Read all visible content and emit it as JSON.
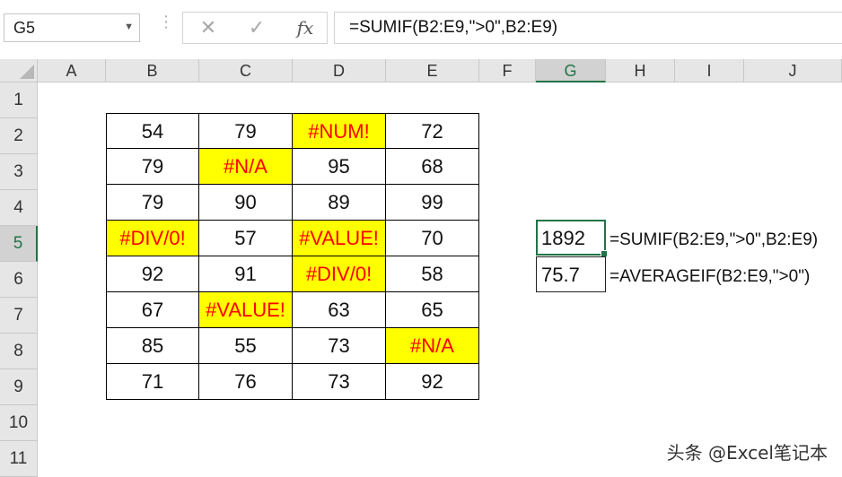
{
  "formula_bar": {
    "name_box": "G5",
    "cancel_symbol": "✕",
    "enter_symbol": "✓",
    "fx_label": "fx",
    "formula": "=SUMIF(B2:E9,\">0\",B2:E9)"
  },
  "columns": [
    "A",
    "B",
    "C",
    "D",
    "E",
    "F",
    "G",
    "H",
    "I",
    "J"
  ],
  "selected_column": "G",
  "rows": [
    "1",
    "2",
    "3",
    "4",
    "5",
    "6",
    "7",
    "8",
    "9",
    "10",
    "11"
  ],
  "selected_row": "5",
  "table": [
    [
      "54",
      "79",
      "#NUM!",
      "72"
    ],
    [
      "79",
      "#N/A",
      "95",
      "68"
    ],
    [
      "79",
      "90",
      "89",
      "99"
    ],
    [
      "#DIV/0!",
      "57",
      "#VALUE!",
      "70"
    ],
    [
      "92",
      "91",
      "#DIV/0!",
      "58"
    ],
    [
      "67",
      "#VALUE!",
      "63",
      "65"
    ],
    [
      "85",
      "55",
      "73",
      "#N/A"
    ],
    [
      "71",
      "76",
      "73",
      "92"
    ]
  ],
  "results": {
    "sum_value": "1892",
    "sum_formula": "=SUMIF(B2:E9,\">0\",B2:E9)",
    "avg_value": "75.7",
    "avg_formula": "=AVERAGEIF(B2:E9,\">0\")"
  },
  "watermark": "头条 @Excel笔记本",
  "colors": {
    "error_fill": "#ffff00",
    "error_text": "#ff0000",
    "selection_accent": "#217346"
  }
}
